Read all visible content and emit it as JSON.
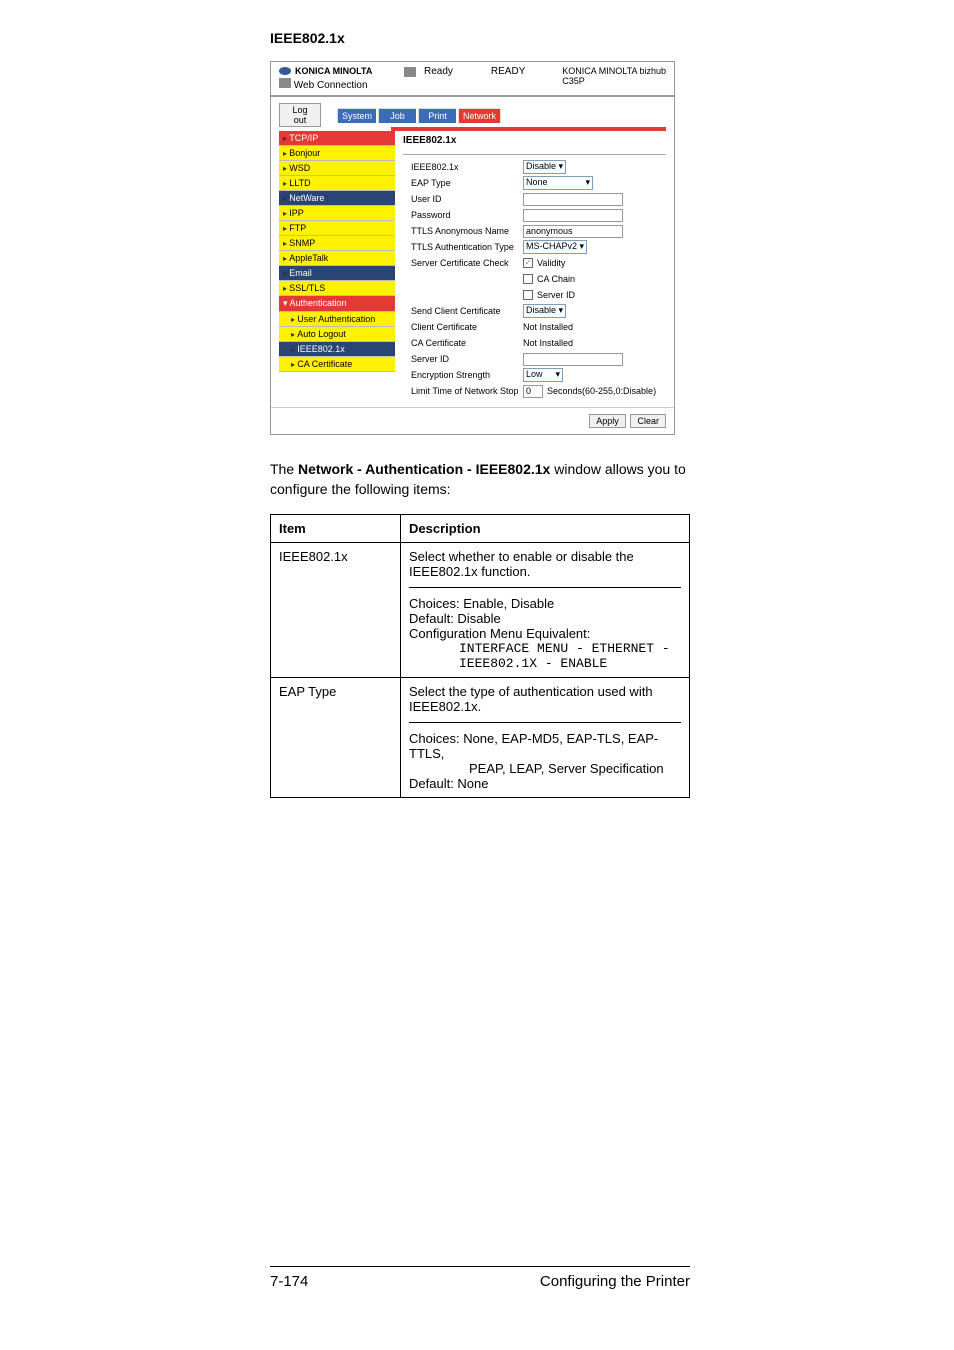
{
  "section_title": "IEEE802.1x",
  "screenshot": {
    "brand": "KONICA MINOLTA",
    "web_conn": "Web Connection",
    "status_label": "Ready",
    "status_value": "READY",
    "model_line1": "KONICA MINOLTA bizhub",
    "model_line2": "C35P",
    "logout": "Log out",
    "tabs": {
      "system": "System",
      "job": "Job",
      "print": "Print",
      "network": "Network"
    },
    "sidebar": {
      "tcpip": "TCP/IP",
      "bonjour": "Bonjour",
      "wsd": "WSD",
      "lltd": "LLTD",
      "netware": "NetWare",
      "ipp": "IPP",
      "ftp": "FTP",
      "snmp": "SNMP",
      "appletalk": "AppleTalk",
      "email": "Email",
      "ssltls": "SSL/TLS",
      "auth": "Authentication",
      "userauth": "User Authentication",
      "autologout": "Auto Logout",
      "ieee": "IEEE802.1x",
      "cacert": "CA Certificate"
    },
    "main_title": "IEEE802.1x",
    "form": {
      "ieee_label": "IEEE802.1x",
      "ieee_value": "Disable",
      "eap_label": "EAP Type",
      "eap_value": "None",
      "userid_label": "User ID",
      "password_label": "Password",
      "ttls_anon_label": "TTLS Anonymous Name",
      "ttls_anon_value": "anonymous",
      "ttls_auth_label": "TTLS Authentication Type",
      "ttls_auth_value": "MS-CHAPv2",
      "scc_label": "Server Certificate Check",
      "scc_validity": "Validity",
      "scc_cachain": "CA Chain",
      "scc_serverid": "Server ID",
      "send_cc_label": "Send Client Certificate",
      "send_cc_value": "Disable",
      "client_cert_label": "Client Certificate",
      "client_cert_value": "Not Installed",
      "ca_cert_label": "CA Certificate",
      "ca_cert_value": "Not Installed",
      "serverid_label": "Server ID",
      "enc_strength_label": "Encryption Strength",
      "enc_strength_value": "Low",
      "limit_label": "Limit Time of Network Stop",
      "limit_value": "0",
      "limit_hint": "Seconds(60-255,0:Disable)"
    },
    "buttons": {
      "apply": "Apply",
      "clear": "Clear"
    }
  },
  "intro_prefix": "The ",
  "intro_bold": "Network - Authentication - IEEE802.1x",
  "intro_suffix": " window allows you to configure the following items:",
  "table": {
    "h1": "Item",
    "h2": "Description",
    "row1_item": "IEEE802.1x",
    "row1_p1": "Select whether to enable or disable the IEEE802.1x function.",
    "row1_choices": "Choices: Enable, Disable",
    "row1_default": "Default:  Disable",
    "row1_config": "Configuration Menu Equivalent:",
    "row1_mono1": "INTERFACE MENU - ETHERNET -",
    "row1_mono2": "IEEE802.1X - ENABLE",
    "row2_item": "EAP Type",
    "row2_p1": "Select the type of authentication used with IEEE802.1x.",
    "row2_choices": "Choices: None, EAP-MD5, EAP-TLS, EAP-TTLS, PEAP, LEAP, Server Specification",
    "row2_default": "Default:  None"
  },
  "footer": {
    "page": "7-174",
    "title": "Configuring the Printer"
  }
}
